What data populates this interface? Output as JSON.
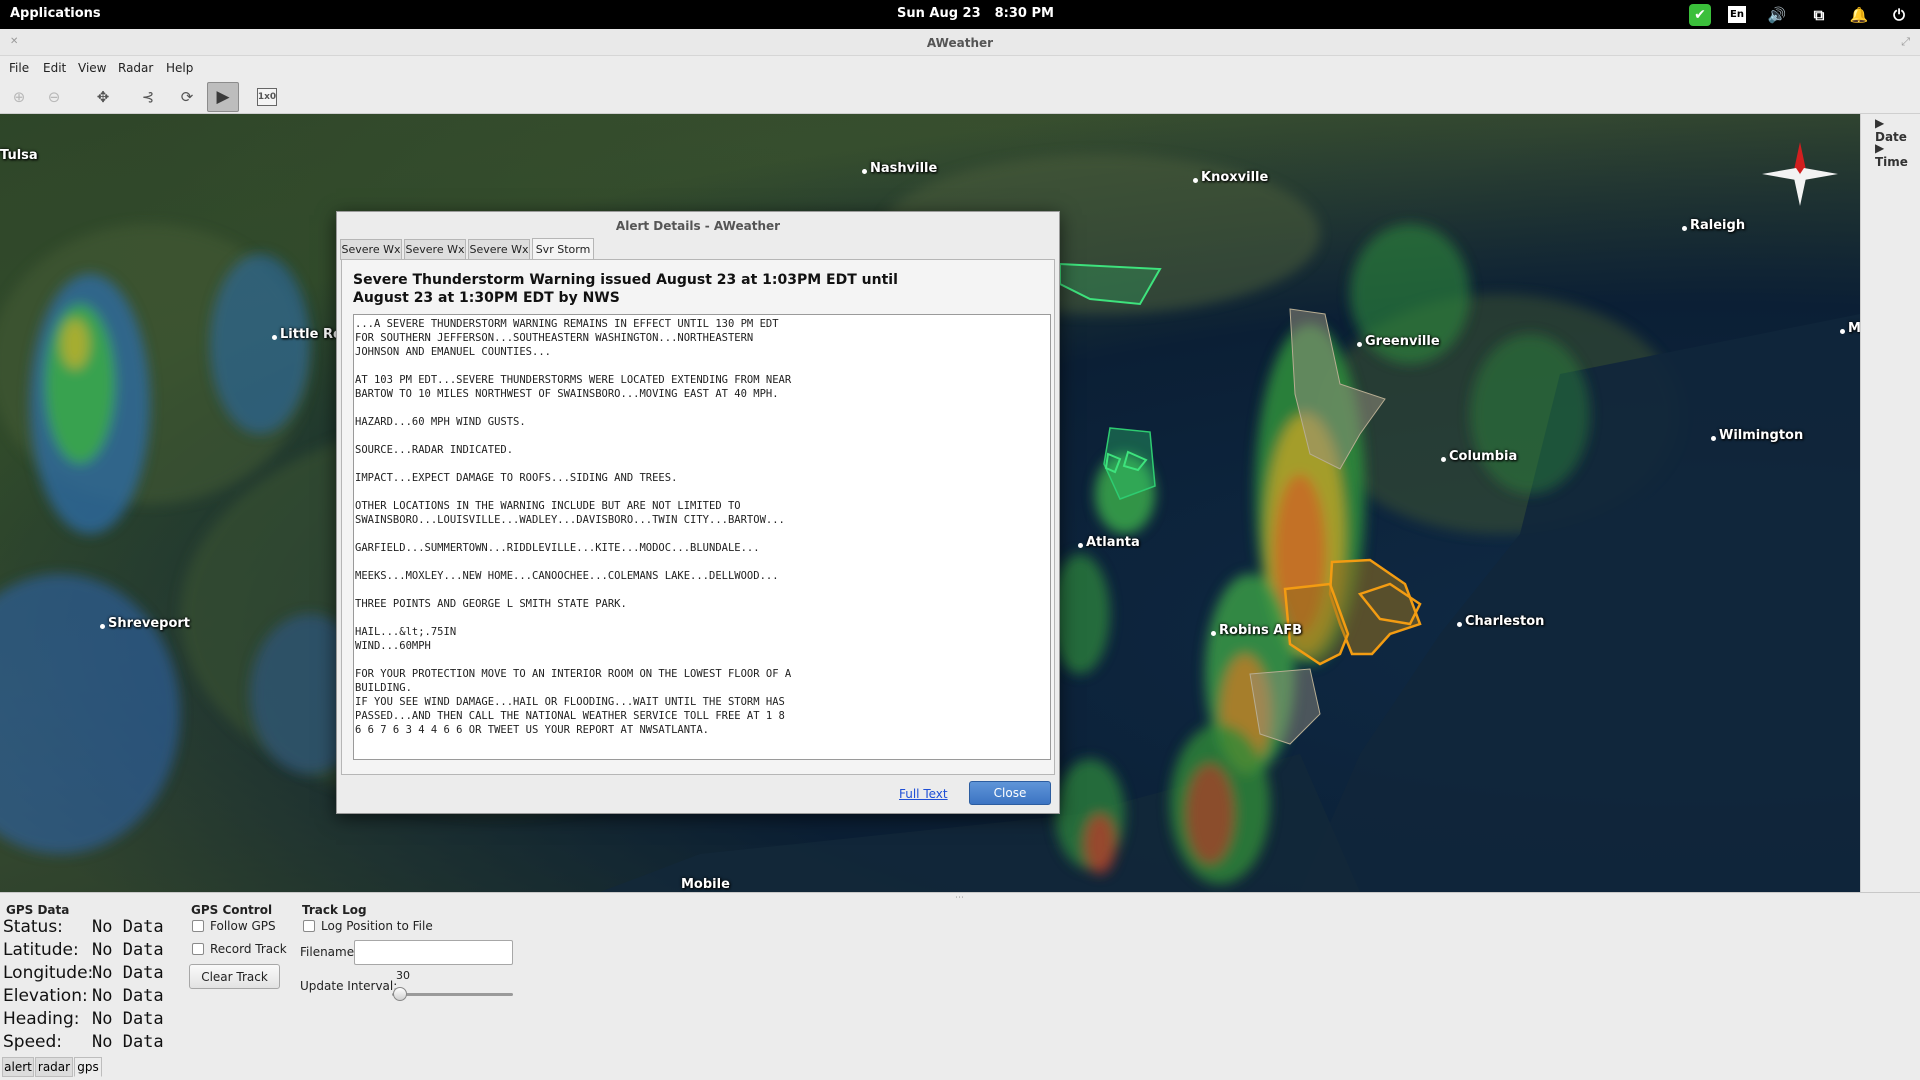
{
  "system_bar": {
    "applications": "Applications",
    "date": "Sun Aug 23",
    "time": "8:30 PM",
    "lang": "En"
  },
  "window": {
    "title": "AWeather"
  },
  "menu": [
    "File",
    "Edit",
    "View",
    "Radar",
    "Help"
  ],
  "toolbar": {
    "speed_icon_text": "1x0"
  },
  "map": {
    "cities": [
      "Tulsa",
      "Nashville",
      "Knoxville",
      "Raleigh",
      "Little Rock",
      "Greenville",
      "Columbia",
      "Wilmington",
      "Atlanta",
      "Robins AFB",
      "Charleston",
      "Shreveport",
      "Mobile",
      "M"
    ]
  },
  "side_panel": {
    "date_label": "Date",
    "time_label": "Time"
  },
  "dialog": {
    "title": "Alert Details - AWeather",
    "tabs": [
      "Severe Wx",
      "Severe Wx",
      "Severe Wx",
      "Svr Storm"
    ],
    "heading": "Severe Thunderstorm Warning issued August 23 at 1:03PM EDT until August 23 at 1:30PM EDT by NWS",
    "body": "...A SEVERE THUNDERSTORM WARNING REMAINS IN EFFECT UNTIL 130 PM EDT\nFOR SOUTHERN JEFFERSON...SOUTHEASTERN WASHINGTON...NORTHEASTERN\nJOHNSON AND EMANUEL COUNTIES...\n\nAT 103 PM EDT...SEVERE THUNDERSTORMS WERE LOCATED EXTENDING FROM NEAR\nBARTOW TO 10 MILES NORTHWEST OF SWAINSBORO...MOVING EAST AT 40 MPH.\n\nHAZARD...60 MPH WIND GUSTS.\n\nSOURCE...RADAR INDICATED.\n\nIMPACT...EXPECT DAMAGE TO ROOFS...SIDING AND TREES.\n\nOTHER LOCATIONS IN THE WARNING INCLUDE BUT ARE NOT LIMITED TO\nSWAINSBORO...LOUISVILLE...WADLEY...DAVISBORO...TWIN CITY...BARTOW...\n\nGARFIELD...SUMMERTOWN...RIDDLEVILLE...KITE...MODOC...BLUNDALE...\n\nMEEKS...MOXLEY...NEW HOME...CANOOCHEE...COLEMANS LAKE...DELLWOOD...\n\nTHREE POINTS AND GEORGE L SMITH STATE PARK.\n\nHAIL...&lt;.75IN\nWIND...60MPH\n\nFOR YOUR PROTECTION MOVE TO AN INTERIOR ROOM ON THE LOWEST FLOOR OF A\nBUILDING.\nIF YOU SEE WIND DAMAGE...HAIL OR FLOODING...WAIT UNTIL THE STORM HAS\nPASSED...AND THEN CALL THE NATIONAL WEATHER SERVICE TOLL FREE AT 1 8\n6 6 7 6 3 4 4 6 6 OR TWEET US YOUR REPORT AT NWSATLANTA.",
    "full_text_link": "Full Text",
    "close_button": "Close"
  },
  "gps_panel": {
    "gps_data_header": "GPS Data",
    "rows": [
      {
        "label": "Status:",
        "value": "No Data"
      },
      {
        "label": "Latitude:",
        "value": "No Data"
      },
      {
        "label": "Longitude:",
        "value": "No Data"
      },
      {
        "label": "Elevation:",
        "value": "No Data"
      },
      {
        "label": "Heading:",
        "value": "No Data"
      },
      {
        "label": "Speed:",
        "value": "No Data"
      }
    ],
    "gps_control_header": "GPS Control",
    "follow_gps": "Follow GPS",
    "record_track": "Record Track",
    "clear_track": "Clear Track",
    "track_log_header": "Track Log",
    "log_position": "Log Position to File",
    "filename_label": "Filename:",
    "filename_value": "",
    "update_interval_label": "Update Interval:",
    "update_interval_value": "30"
  },
  "bottom_tabs": [
    "alert",
    "radar",
    "gps"
  ]
}
